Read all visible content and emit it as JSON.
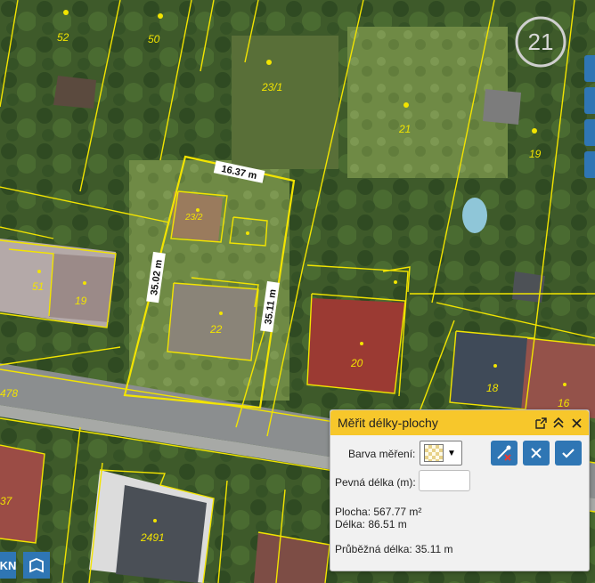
{
  "map": {
    "parcel_labels": [
      "52",
      "50",
      "23/1",
      "21",
      "19",
      "23/2",
      "51",
      "19",
      "22",
      "20",
      "18",
      "16",
      "478",
      "37",
      "2491"
    ],
    "dimension_labels": [
      "16.37 m",
      "35.02 m",
      "35.11 m"
    ]
  },
  "panel": {
    "title": "Měřit délky-plochy",
    "color_label": "Barva měření:",
    "fixed_length_label": "Pevná délka (m):",
    "fixed_length_value": "",
    "area_text": "Plocha: 567.77 m²",
    "length_text": "Délka: 86.51 m",
    "running_length_text": "Průběžná délka: 35.11 m"
  },
  "bottom_buttons": {
    "kn_label": "KN"
  },
  "colors": {
    "accent": "#f7c72b",
    "button": "#2f76b4",
    "parcel_line": "#f2e400"
  }
}
